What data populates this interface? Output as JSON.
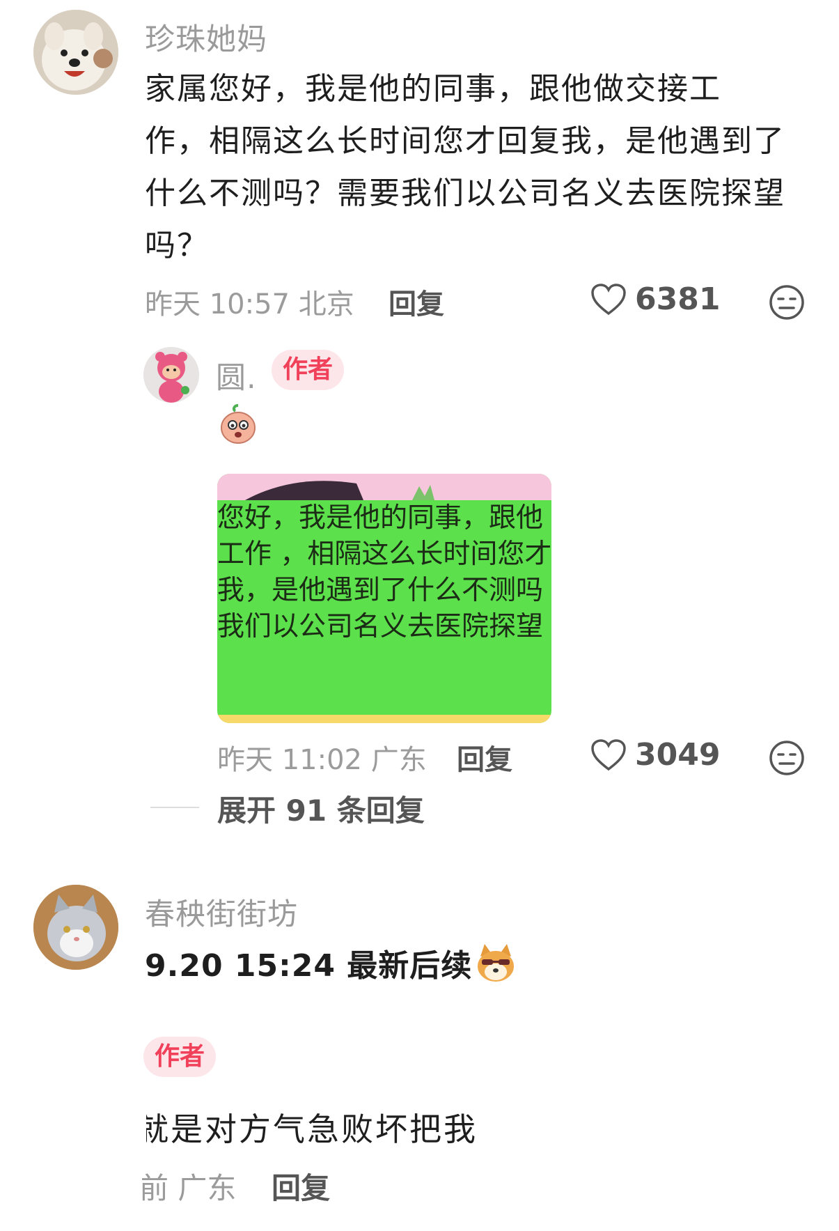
{
  "comments": [
    {
      "author": "珍珠她妈",
      "text_lines": [
        "家属您好，我是他的同事，跟他做交接工",
        "作，相隔这么长时间您才回复我，是他遇到了",
        "什么不测吗？需要我们以公司名义去医院探望",
        "吗？"
      ],
      "time": "昨天 10:57 北京",
      "reply_label": "回复",
      "likes": "6381",
      "avatar_icon": "dog-avatar-icon"
    },
    {
      "author": "圆.",
      "badge": "作者",
      "emoji_icon": "peach-shocked-emoji-icon",
      "image_text_lines": [
        "您好，我是他的同事，跟他",
        "工作 ，相隔这么长时间您才",
        "我，是他遇到了什么不测吗",
        "我们以公司名义去医院探望"
      ],
      "time": "昨天 11:02 广东",
      "reply_label": "回复",
      "likes": "3049",
      "expand_label": "展开 91 条回复",
      "avatar_icon": "pink-bear-avatar-icon"
    },
    {
      "author": "春秧街街坊",
      "text": "9.20 15:24 最新后续",
      "emoji_icon": "shiba-sunglasses-emoji-icon",
      "avatar_icon": "cat-avatar-icon"
    }
  ],
  "inner_reply": {
    "badge": "作者",
    "text": "就是对方气急败坏把我",
    "time": "前 广东",
    "reply_label": "回复"
  },
  "colors": {
    "badge_bg": "#fde6ea",
    "badge_text": "#f0405a",
    "image_green": "#5ce04c",
    "meta_gray": "#9b9b9b"
  }
}
